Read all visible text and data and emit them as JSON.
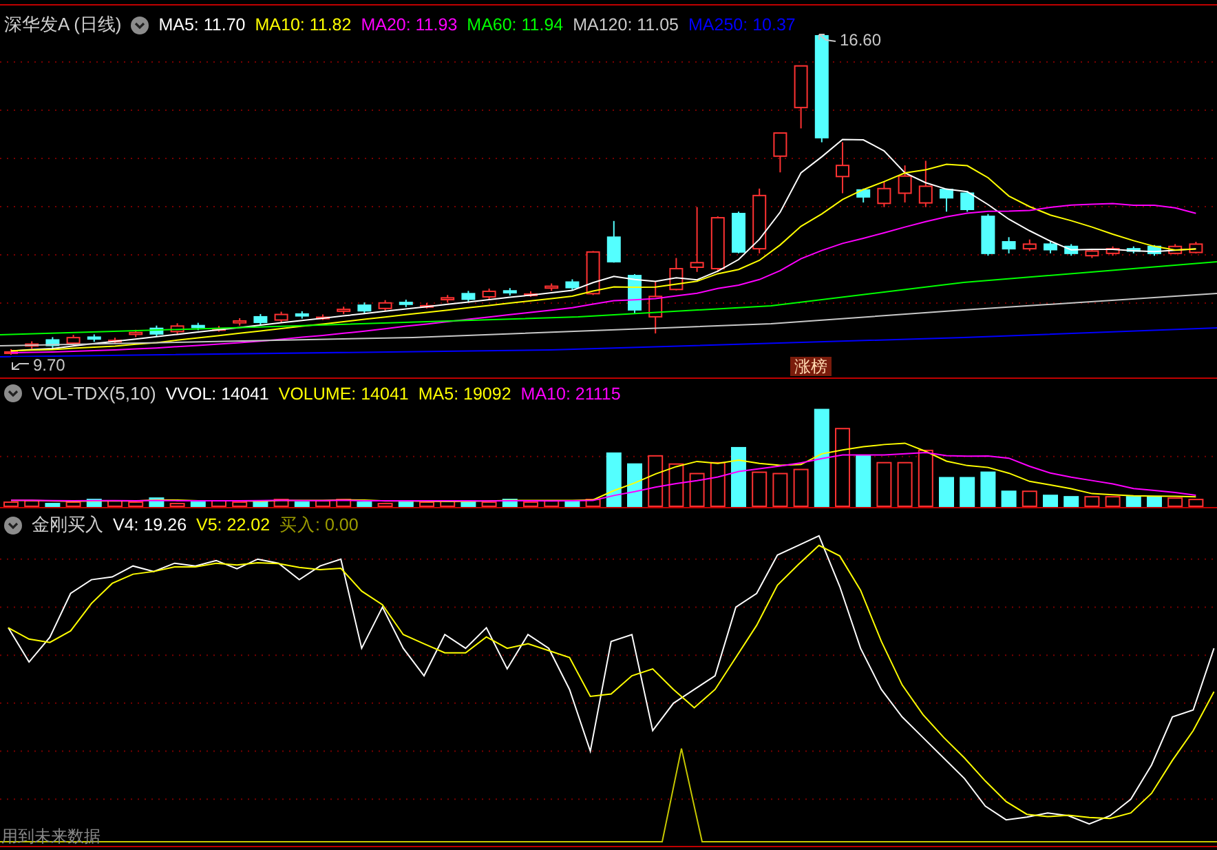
{
  "main_panel": {
    "title": "深华发A (日线)",
    "indicators": [
      {
        "label": "MA5: 11.70",
        "color": "#ffffff"
      },
      {
        "label": "MA10: 11.82",
        "color": "#ffff00"
      },
      {
        "label": "MA20: 11.93",
        "color": "#ff00ff"
      },
      {
        "label": "MA60: 11.94",
        "color": "#00ff00"
      },
      {
        "label": "MA120: 11.05",
        "color": "#c8c8c8"
      },
      {
        "label": "MA250: 10.37",
        "color": "#0000ff"
      }
    ],
    "high_label": "16.60",
    "low_label": "9.70",
    "badge": "涨榜"
  },
  "volume_panel": {
    "title": "VOL-TDX(5,10)",
    "indicators": [
      {
        "label": "VVOL: 14041",
        "color": "#ffffff"
      },
      {
        "label": "VOLUME: 14041",
        "color": "#ffff00"
      },
      {
        "label": "MA5: 19092",
        "color": "#ffff00"
      },
      {
        "label": "MA10: 21115",
        "color": "#ff00ff"
      }
    ]
  },
  "signal_panel": {
    "title": "金刚买入",
    "indicators": [
      {
        "label": "V4: 19.26",
        "color": "#ffffff"
      },
      {
        "label": "V5: 22.02",
        "color": "#ffff00"
      },
      {
        "label": "买入: 0.00",
        "color": "#9c9c00"
      }
    ],
    "note": "用到未来数据"
  }
}
